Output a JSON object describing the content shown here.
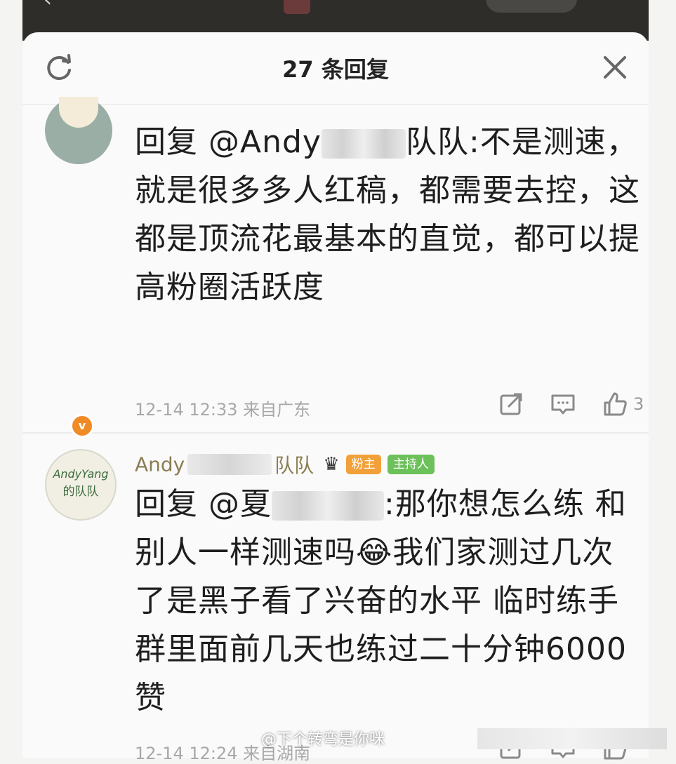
{
  "sheet": {
    "title": "27 条回复",
    "refresh_icon": "refresh-icon",
    "close_icon": "close-icon"
  },
  "comments": [
    {
      "reply_prefix": "回复 @Andy",
      "reply_suffix": "队队",
      "body_1": ":不是测速，就是很多多人红稿，都需要去控，这都是顶流花最基本的直觉，都可以提高粉圈活跃度",
      "date": "12-14 12:33",
      "location": "来自广东",
      "likes": "3"
    },
    {
      "username_prefix": "Andy",
      "username_suffix": "队队",
      "avatar_line1": "AndyYang",
      "avatar_line2": "的队队",
      "badge_fan": "粉主",
      "badge_host": "主持人",
      "reply_prefix": "回复 @夏",
      "body": ":那你想怎么练 和别人一样测速吗😂我们家测过几次了是黑子看了兴奋的水平 临时练手群里面前几天也练过二十分钟6000赞",
      "date": "12-14 12:24",
      "location": "来自湖南"
    }
  ],
  "watermark": "@下个转弯是你咪"
}
